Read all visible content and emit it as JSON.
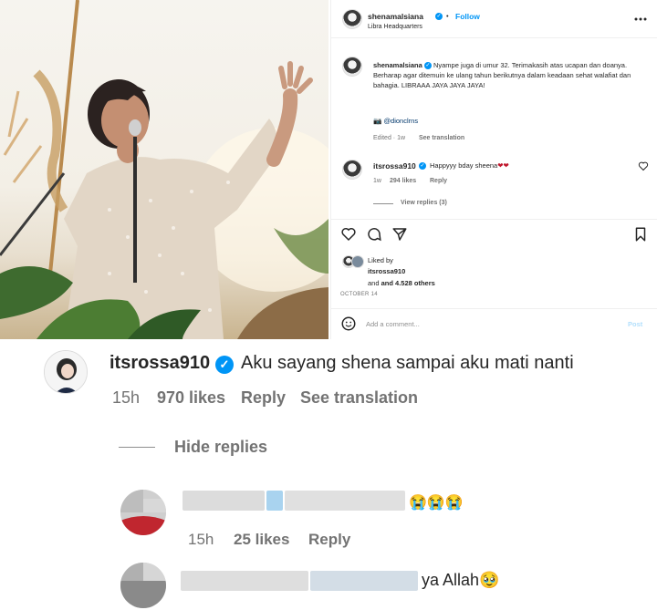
{
  "post": {
    "username": "shenamalsiana",
    "follow_label": "Follow",
    "location": "Libra Headquarters",
    "caption": "Nyampe juga di umur 32. Terimakasih atas ucapan dan doanya. Berharap agar ditemuin ke ulang tahun berikutnya dalam keadaan sehat walafiat dan bahagia. LIBRAAA JAYA JAYA JAYA!",
    "caption_mention": "@dionclrns",
    "caption_meta": "Edited · 1w",
    "see_translation": "See translation",
    "more_icon": "more-horizontal-icon"
  },
  "top_comment": {
    "username": "itsrossa910",
    "text": "Happyyy bday sheena",
    "hearts": "❤❤",
    "time": "1w",
    "likes": "294 likes",
    "reply": "Reply",
    "view_replies": "View replies (3)"
  },
  "actions": {
    "icons": [
      "heart-icon",
      "comment-icon",
      "share-icon",
      "bookmark-icon"
    ]
  },
  "likes_summary": {
    "liked_by_label": "Liked by",
    "liked_by_user": "itsrossa910",
    "and_others": "and 4.528 others",
    "date": "OCTOBER 14"
  },
  "add_comment": {
    "placeholder": "Add a comment...",
    "post_label": "Post"
  },
  "zoom_comment": {
    "username": "itsrossa910",
    "text": "Aku sayang shena sampai aku mati nanti",
    "time": "15h",
    "likes": "970 likes",
    "reply": "Reply",
    "see_translation": "See translation",
    "hide_replies": "Hide replies"
  },
  "replies": [
    {
      "emoji": "😭😭😭",
      "time": "15h",
      "likes": "25 likes",
      "reply": "Reply"
    },
    {
      "text": "ya Allah🥹"
    }
  ]
}
